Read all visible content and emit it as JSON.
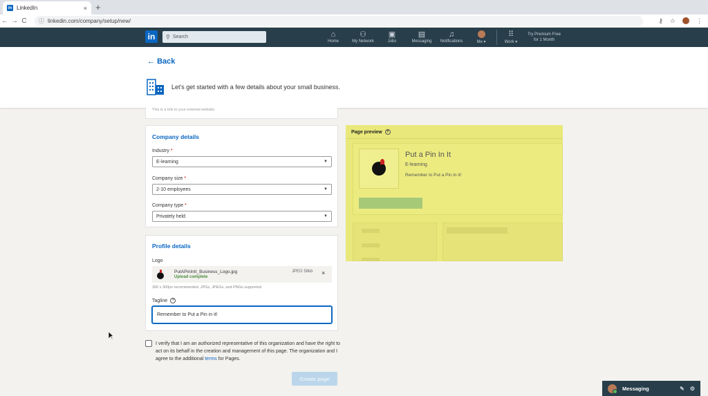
{
  "browser": {
    "tab_title": "LinkedIn",
    "tab_close": "×",
    "new_tab": "+",
    "url": "linkedin.com/company/setup/new/",
    "back": "←",
    "forward": "→",
    "reload": "C"
  },
  "header": {
    "logo": "in",
    "search_placeholder": "Search",
    "nav": [
      {
        "label": "Home",
        "icon": "home-icon"
      },
      {
        "label": "My Network",
        "icon": "network-icon"
      },
      {
        "label": "Jobs",
        "icon": "briefcase-icon"
      },
      {
        "label": "Messaging",
        "icon": "chat-icon"
      },
      {
        "label": "Notifications",
        "icon": "bell-icon"
      },
      {
        "label": "Me ▾",
        "icon": "avatar"
      },
      {
        "label": "Work ▾",
        "icon": "grid-icon"
      }
    ],
    "premium_line1": "Try Premium Free",
    "premium_line2": "for 1 Month"
  },
  "banner": {
    "back_label": "Back",
    "intro": "Let's get started with a few details about your small business."
  },
  "website_card": {
    "hint": "This is a link to your external website."
  },
  "company_details": {
    "title": "Company details",
    "industry_label": "Industry",
    "industry_value": "E-learning",
    "size_label": "Company size",
    "size_value": "2-10 employees",
    "type_label": "Company type",
    "type_value": "Privately held",
    "required_mark": "*"
  },
  "profile_details": {
    "title": "Profile details",
    "logo_label": "Logo",
    "file_name": "PutAPinInIt_Business_Logo.jpg",
    "file_status": "Upload complete",
    "file_size": "JPEG 58kb",
    "file_remove": "×",
    "logo_hint": "300 x 300px recommended. JPGs, JPEGs, and PNGs supported.",
    "tagline_label": "Tagline",
    "tagline_value": "Remember to Put a Pin in it!"
  },
  "verify": {
    "text_before": "I verify that I am an authorized representative of this organization and have the right to act on its behalf in the creation and management of this page. The organization and I agree to the additional ",
    "link": "terms",
    "text_after": " for Pages."
  },
  "create_button": "Create page",
  "preview": {
    "title": "Page preview",
    "company_name": "Put a Pin In It",
    "industry": "E-learning",
    "tagline": "Remember to Put a Pin in it!"
  },
  "messaging": {
    "label": "Messaging"
  },
  "colors": {
    "brand": "#0a66c2",
    "header_bg": "#283e4a",
    "preview_highlight": "#e9e87a"
  }
}
